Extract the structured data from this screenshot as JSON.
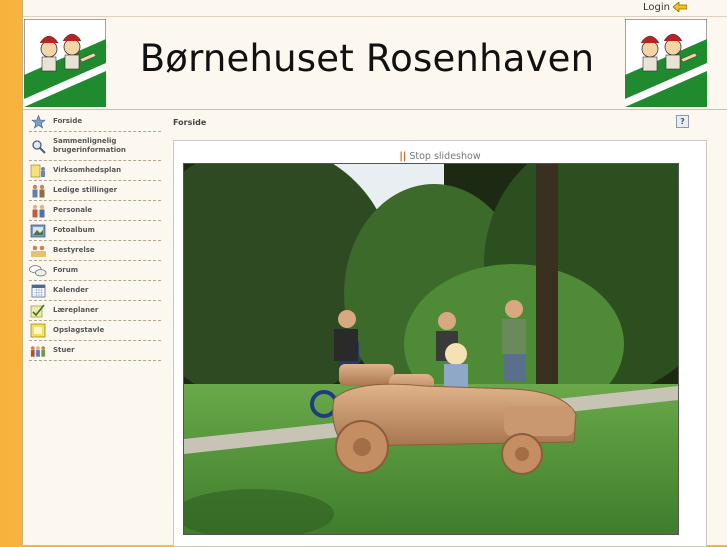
{
  "topbar": {
    "login_label": "Login"
  },
  "header": {
    "title": "Børnehuset Rosenhaven"
  },
  "sidebar": {
    "items": [
      {
        "label": "Forside",
        "icon": "star-icon"
      },
      {
        "label": "Sammenlignelig brugerinformation",
        "icon": "magnifier-icon"
      },
      {
        "label": "Virksomhedsplan",
        "icon": "document-people-icon"
      },
      {
        "label": "Ledige stillinger",
        "icon": "people-icon"
      },
      {
        "label": "Personale",
        "icon": "staff-icon"
      },
      {
        "label": "Fotoalbum",
        "icon": "photo-album-icon"
      },
      {
        "label": "Bestyrelse",
        "icon": "board-icon"
      },
      {
        "label": "Forum",
        "icon": "speech-bubbles-icon"
      },
      {
        "label": "Kalender",
        "icon": "calendar-icon"
      },
      {
        "label": "Læreplaner",
        "icon": "checklist-icon"
      },
      {
        "label": "Opslagstavle",
        "icon": "notice-board-icon"
      },
      {
        "label": "Stuer",
        "icon": "group-icon"
      }
    ]
  },
  "content": {
    "breadcrumb": "Forside",
    "help_label": "?",
    "slideshow_label": "Stop slideshow"
  },
  "colors": {
    "sidebar_bg": "#f6b23c",
    "page_bg": "#fdf8ef",
    "accent": "#d15a1a"
  }
}
